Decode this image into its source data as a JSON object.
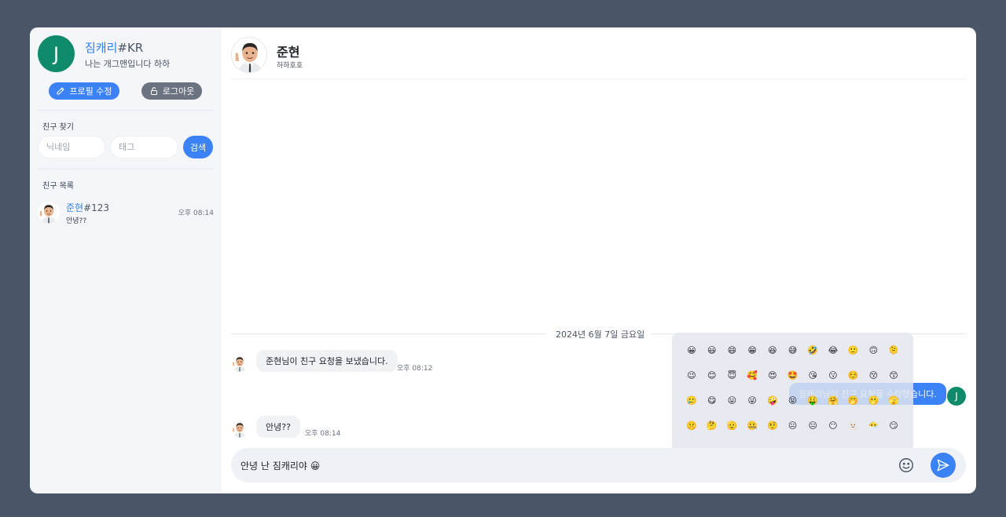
{
  "profile": {
    "avatar_letter": "J",
    "name": "짐캐리",
    "tag": "#KR",
    "status": "나는 개그맨입니다 하하"
  },
  "buttons": {
    "edit_profile": "프로필 수정",
    "logout": "로그아웃",
    "search": "검색"
  },
  "search": {
    "label": "친구 찾기",
    "nickname_placeholder": "닉네임",
    "tag_placeholder": "태그"
  },
  "friends": {
    "label": "친구 목록",
    "items": [
      {
        "name": "준현",
        "tag": "#123",
        "last_message": "안녕??",
        "time": "오후 08:14"
      }
    ]
  },
  "chat": {
    "name": "준현",
    "status": "하하호호",
    "date": "2024년 6월 7일 금요일",
    "messages": [
      {
        "text": "준현님이 친구 요청을 보냈습니다.",
        "time": "오후 08:12"
      },
      {
        "text": "짐캐리님이 친구 요청을 수락했습니다.",
        "avatar": "J"
      },
      {
        "text": "안녕??",
        "time": "오후 08:14"
      }
    ]
  },
  "composer": {
    "value": "안녕 난 짐캐리야 😀"
  },
  "emoji_picker": {
    "rows": [
      [
        "😀",
        "😃",
        "😄",
        "😁",
        "😆",
        "😅",
        "🤣",
        "😂",
        "🙂",
        "🙃",
        "🫠"
      ],
      [
        "😉",
        "😊",
        "😇",
        "🥰",
        "😍",
        "🤩",
        "😘",
        "😗",
        "☺️",
        "😚",
        "😙"
      ],
      [
        "🥲",
        "😋",
        "😛",
        "😜",
        "🤪",
        "😝",
        "🤑",
        "🤗",
        "🤭",
        "🫢",
        "🫣"
      ],
      [
        "🤫",
        "🤔",
        "🫡",
        "🤐",
        "🤨",
        "😐",
        "😑",
        "😶",
        "🫥",
        "😶‍🌫️",
        "😏"
      ]
    ]
  },
  "colors": {
    "background": "#4a5568",
    "accent": "#3b82f6",
    "avatar_green": "#0f8a6b",
    "sidebar": "#f4f6f9"
  }
}
